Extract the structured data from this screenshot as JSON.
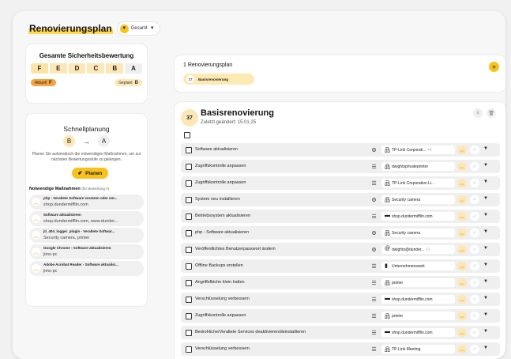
{
  "app": {
    "title": "Renovierungsplan",
    "scope": "Gesamt"
  },
  "rating": {
    "title": "Gesamte Sicherheitsbewertung",
    "grades": [
      "F",
      "E",
      "D",
      "C",
      "B",
      "A"
    ],
    "current_label": "Aktuell",
    "current_value": "F",
    "planned_label": "Geplant",
    "planned_value": "B"
  },
  "quick": {
    "title": "Schnellplanung",
    "from": "B",
    "arrow": "→",
    "to": "A",
    "description": "Planen Sie automatisch die notwendigen Maßnahmen, um zur nächsten Bewertungsstufe zu gelangen.",
    "button": "Planen",
    "measures_title": "Notwendige Maßnahmen",
    "measures_hint": "(für Bewertung A)",
    "measures": [
      {
        "title": "php - Veraltete Software ersetzen oder ent...",
        "target": "shop.dundermifflin.com"
      },
      {
        "title": "Software aktualisieren",
        "target": "shop.dundermifflin.com, www.dunder..."
      },
      {
        "title": "jti_404_logger_plugin - Veraltete Softwar...",
        "target": "Security camera, printer"
      },
      {
        "title": "Google Chrome - Software aktualisieren",
        "target": "jims-pc"
      },
      {
        "title": "Adobe Acrobat Reader - Software aktualisi...",
        "target": "jims-pc"
      }
    ]
  },
  "plans": {
    "count_title": "1 Renovierungsplan",
    "chip_number": "37",
    "chip_label": "Basisrenovierung"
  },
  "detail": {
    "number": "37",
    "title": "Basisrenovierung",
    "subtitle": "Zuletzt geändert: 15.01.25",
    "rows": [
      {
        "name": "Software aktualisieren",
        "type": "gear",
        "asset_icon": "network",
        "asset": "TP-Link Corporati...",
        "extra": "+4"
      },
      {
        "name": "Zugriffskontrolle anpassen",
        "type": "list",
        "asset_icon": "network",
        "asset": "dwightsprivateprinter",
        "extra": ""
      },
      {
        "name": "Zugriffskontrolle anpassen",
        "type": "list",
        "asset_icon": "network",
        "asset": "TP-Link Corporation Li...",
        "extra": ""
      },
      {
        "name": "System neu installieren",
        "type": "gear",
        "asset_icon": "network",
        "asset": "Security camera",
        "extra": ""
      },
      {
        "name": "Betriebssystem aktualisieren",
        "type": "list",
        "asset_icon": "server",
        "asset": "shop.dundermifflin.com",
        "extra": ""
      },
      {
        "name": "php - Software aktualisieren",
        "type": "gear",
        "asset_icon": "network",
        "asset": "Security camera",
        "extra": ""
      },
      {
        "name": "Veröffentlichtes Benutzerpasswort ändern",
        "type": "gear",
        "asset_icon": "at",
        "asset": "dwights@dunder...",
        "extra": "+1"
      },
      {
        "name": "Offline Backups erstellen",
        "type": "list",
        "asset_icon": "building",
        "asset": "Unternehmensweit",
        "extra": ""
      },
      {
        "name": "Angriffsfläche klein halten",
        "type": "list",
        "asset_icon": "network",
        "asset": "printer",
        "extra": ""
      },
      {
        "name": "Verschlüsselung verbessern",
        "type": "list",
        "asset_icon": "server",
        "asset": "shop.dundermifflin.com",
        "extra": ""
      },
      {
        "name": "Zugriffskontrolle anpassen",
        "type": "list",
        "asset_icon": "network",
        "asset": "printer",
        "extra": ""
      },
      {
        "name": "Bedrohliche/Veraltete Services deaktivieren/deinstallieren",
        "type": "list",
        "asset_icon": "server",
        "asset": "shop.dundermifflin.com",
        "extra": ""
      },
      {
        "name": "Verschlüsselung verbessern",
        "type": "list",
        "asset_icon": "network",
        "asset": "TP-Link Meeting",
        "extra": ""
      }
    ]
  },
  "colors": {
    "accent": "#f7c21a",
    "accent_light": "#fde7b7",
    "current": "#f4a340"
  }
}
